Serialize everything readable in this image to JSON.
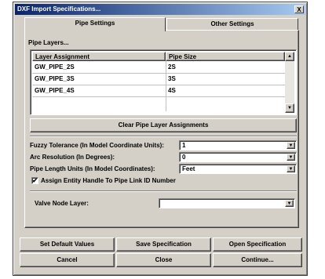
{
  "window": {
    "title": "DXF Import Specifications...",
    "close_glyph": "X"
  },
  "tabs": [
    {
      "label": "Pipe Settings",
      "active": true
    },
    {
      "label": "Other Settings",
      "active": false
    }
  ],
  "pipe_layers": {
    "group_label": "Pipe Layers...",
    "columns": [
      "Layer Assignment",
      "Pipe Size"
    ],
    "rows": [
      {
        "layer": "GW_PIPE_2S",
        "size": "2S"
      },
      {
        "layer": "GW_PIPE_3S",
        "size": "3S"
      },
      {
        "layer": "GW_PIPE_4S",
        "size": "4S"
      }
    ],
    "clear_button": "Clear Pipe Layer Assignments"
  },
  "fields": {
    "fuzzy_tolerance": {
      "label": "Fuzzy Tolerance (In Model Coordinate Units):",
      "value": "1"
    },
    "arc_resolution": {
      "label": "Arc Resolution (In Degrees):",
      "value": "0"
    },
    "pipe_length_units": {
      "label": "Pipe Length Units (In Model Coordinates):",
      "value": "Feet"
    },
    "assign_handle": {
      "label": "Assign Entity Handle To Pipe Link ID Number",
      "checked": true,
      "check_glyph": "✔"
    },
    "valve_node_layer": {
      "label": "Valve Node Layer:",
      "value": ""
    }
  },
  "buttons": {
    "set_default": "Set Default Values",
    "save_spec": "Save Specification",
    "open_spec": "Open Specification",
    "cancel": "Cancel",
    "close": "Close",
    "continue": "Continue..."
  },
  "icons": {
    "scroll_up": "▲",
    "scroll_down": "▼",
    "dropdown": "▼"
  }
}
